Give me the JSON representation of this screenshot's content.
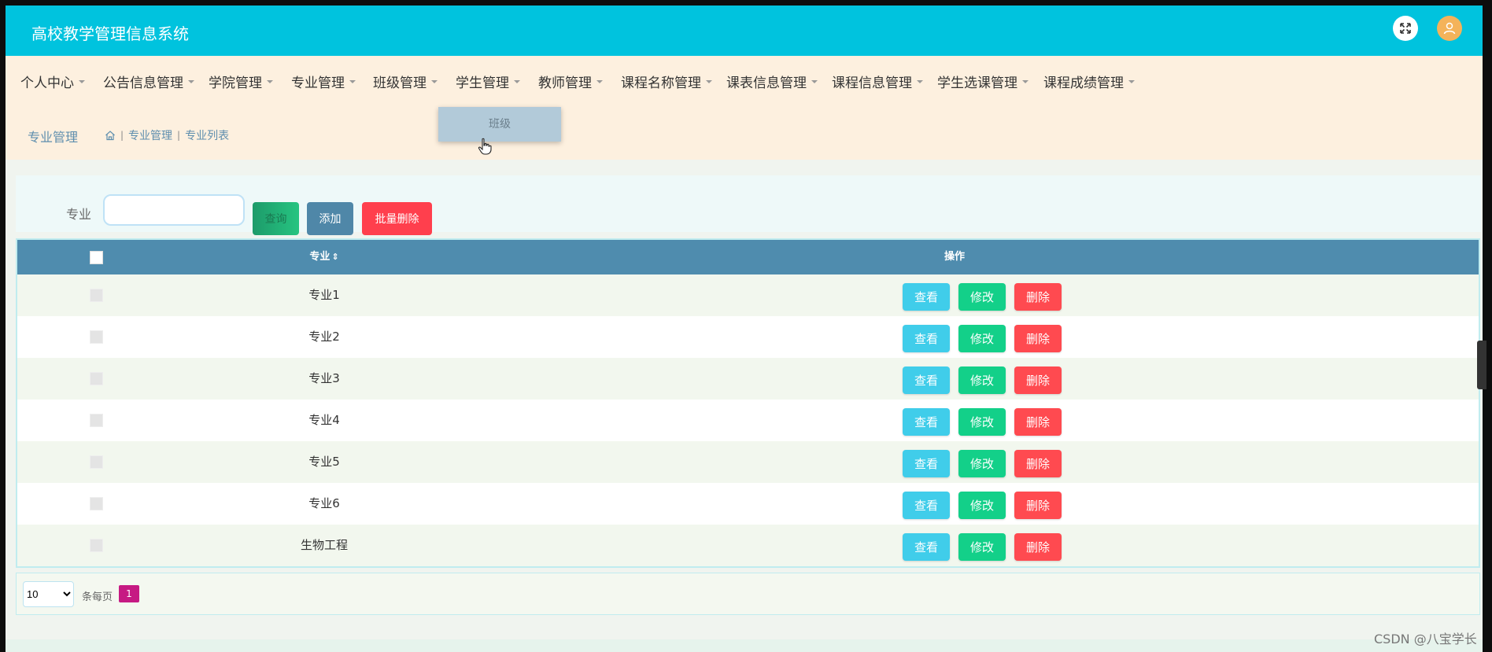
{
  "header": {
    "title": "高校教学管理信息系统"
  },
  "nav": {
    "items": [
      {
        "label": "个人中心"
      },
      {
        "label": "公告信息管理"
      },
      {
        "label": "学院管理"
      },
      {
        "label": "专业管理"
      },
      {
        "label": "班级管理"
      },
      {
        "label": "学生管理"
      },
      {
        "label": "教师管理"
      },
      {
        "label": "课程名称管理"
      },
      {
        "label": "课表信息管理"
      },
      {
        "label": "课程信息管理"
      },
      {
        "label": "学生选课管理"
      },
      {
        "label": "课程成绩管理"
      }
    ],
    "dropdown_item": "班级"
  },
  "breadcrumb": {
    "title": "专业管理",
    "path": [
      "专业管理",
      "专业列表"
    ]
  },
  "search": {
    "label": "专业",
    "value": "",
    "search_button": "查询",
    "add_button": "添加",
    "batch_delete_button": "批量删除"
  },
  "table": {
    "columns": {
      "major": "专业",
      "sort_glyph": "⇕",
      "actions": "操作"
    },
    "rows": [
      {
        "name": "专业1"
      },
      {
        "name": "专业2"
      },
      {
        "name": "专业3"
      },
      {
        "name": "专业4"
      },
      {
        "name": "专业5"
      },
      {
        "name": "专业6"
      },
      {
        "name": "生物工程"
      }
    ],
    "row_actions": {
      "view": "查看",
      "edit": "修改",
      "delete": "删除"
    }
  },
  "pagination": {
    "page_size": "10",
    "page_size_label": "条每页",
    "current_page": "1"
  },
  "watermark": "CSDN @八宝学长"
}
